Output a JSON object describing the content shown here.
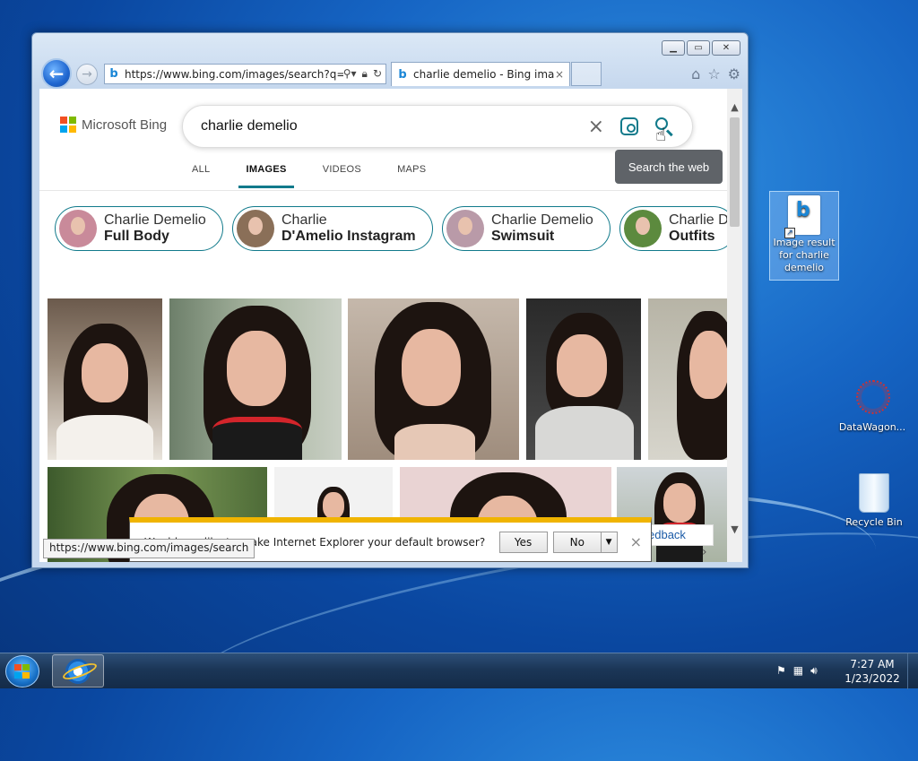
{
  "browser": {
    "address": "https://www.bing.com/images/search?q=",
    "tab_title": "charlie demelio - Bing ima...",
    "tab_close": "×",
    "back_glyph": "←",
    "forward_glyph": "→"
  },
  "bing": {
    "logo_text": "Microsoft Bing",
    "search_value": "charlie demelio",
    "tooltip": "Search the web",
    "nav_tabs": [
      "ALL",
      "IMAGES",
      "VIDEOS",
      "MAPS"
    ],
    "active_tab": "IMAGES",
    "chips": [
      {
        "line1": "Charlie Demelio",
        "line2": "Full Body"
      },
      {
        "line1": "Charlie",
        "line2": "D'Amelio Instagram"
      },
      {
        "line1": "Charlie Demelio",
        "line2": "Swimsuit"
      },
      {
        "line1": "Charlie De",
        "line2": "Outfits"
      }
    ],
    "feedback_label": "edback"
  },
  "notification": {
    "message": "Would you like to make Internet Explorer your default browser?",
    "yes_label": "Yes",
    "no_label": "No",
    "close_glyph": "×"
  },
  "status_url": "https://www.bing.com/images/search",
  "desktop": {
    "icons": [
      {
        "label": "Image result for charlie demelio"
      },
      {
        "label": "DataWagon..."
      },
      {
        "label": "Recycle Bin"
      }
    ]
  },
  "taskbar": {
    "time": "7:27 AM",
    "date": "1/23/2022"
  },
  "colors": {
    "accent": "#117a8b",
    "ms_red": "#f25022",
    "ms_green": "#7fba00",
    "ms_blue": "#00a4ef",
    "ms_yellow": "#ffb900",
    "notif_bar": "#f0b400"
  }
}
